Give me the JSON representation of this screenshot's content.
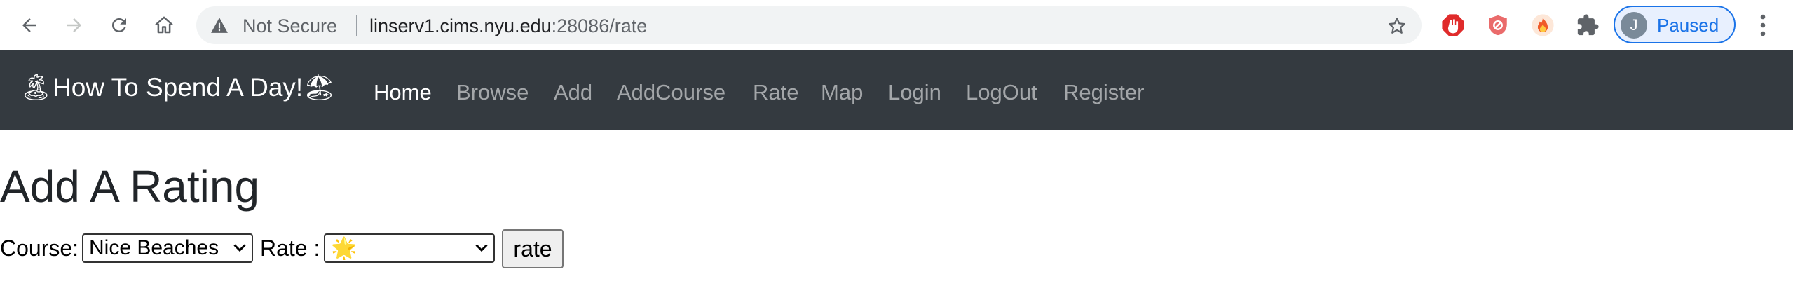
{
  "browser": {
    "security_label": "Not Secure",
    "url_host": "linserv1.cims.nyu.edu",
    "url_rest": ":28086/rate",
    "profile_initial": "J",
    "profile_status": "Paused"
  },
  "navbar": {
    "brand": "🏝How To Spend A Day!🏖",
    "items": [
      {
        "label": "Home",
        "active": true
      },
      {
        "label": "Browse"
      },
      {
        "label": "Add"
      },
      {
        "label": "AddCourse"
      },
      {
        "label": "Rate"
      },
      {
        "label": "Map"
      },
      {
        "label": "Login"
      },
      {
        "label": "LogOut"
      },
      {
        "label": "Register"
      }
    ]
  },
  "page": {
    "heading": "Add A Rating",
    "course_label": "Course:",
    "course_value": "Nice Beaches",
    "rate_label": "Rate :",
    "rate_value": "🌟",
    "submit_label": "rate"
  }
}
